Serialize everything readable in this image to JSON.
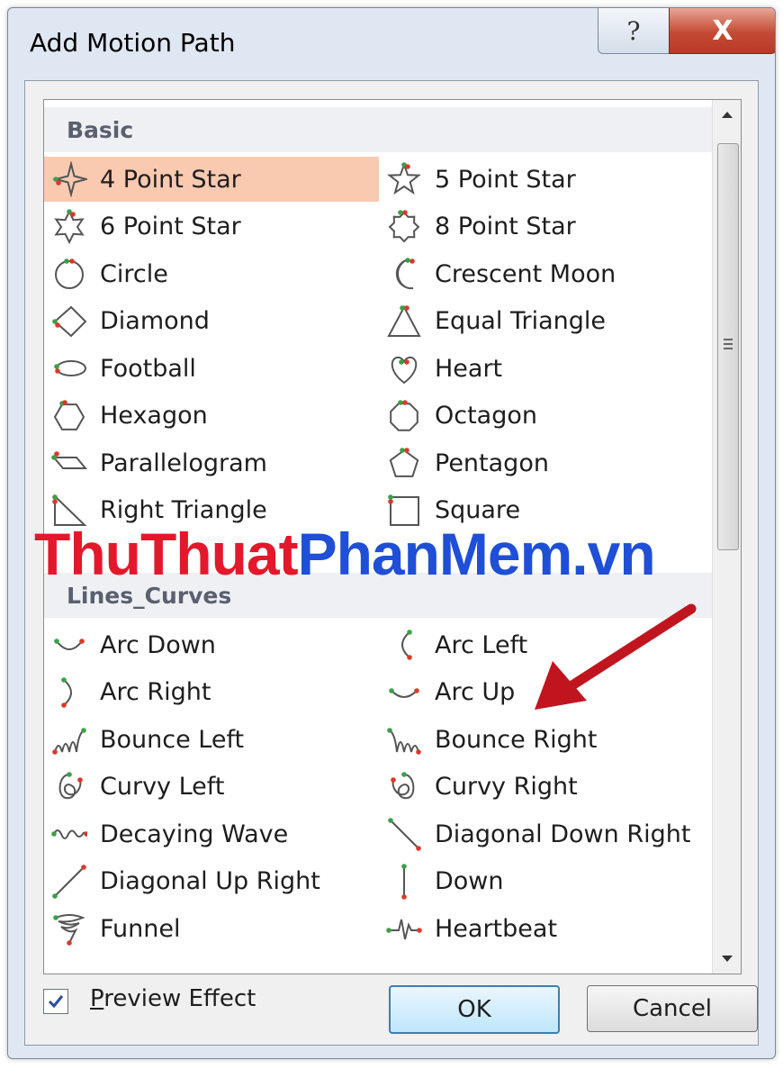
{
  "dialog": {
    "title": "Add Motion Path",
    "help_glyph": "?",
    "close_glyph": "X"
  },
  "groups": [
    {
      "header": "Basic",
      "items": [
        {
          "label": "4 Point Star",
          "icon": "four-point-star-icon",
          "selected": true
        },
        {
          "label": "5 Point Star",
          "icon": "five-point-star-icon"
        },
        {
          "label": "6 Point Star",
          "icon": "six-point-star-icon"
        },
        {
          "label": "8 Point Star",
          "icon": "eight-point-star-icon"
        },
        {
          "label": "Circle",
          "icon": "circle-icon"
        },
        {
          "label": "Crescent Moon",
          "icon": "crescent-moon-icon"
        },
        {
          "label": "Diamond",
          "icon": "diamond-icon"
        },
        {
          "label": "Equal Triangle",
          "icon": "equal-triangle-icon"
        },
        {
          "label": "Football",
          "icon": "football-icon"
        },
        {
          "label": "Heart",
          "icon": "heart-icon"
        },
        {
          "label": "Hexagon",
          "icon": "hexagon-icon"
        },
        {
          "label": "Octagon",
          "icon": "octagon-icon"
        },
        {
          "label": "Parallelogram",
          "icon": "parallelogram-icon"
        },
        {
          "label": "Pentagon",
          "icon": "pentagon-icon"
        },
        {
          "label": "Right Triangle",
          "icon": "right-triangle-icon"
        },
        {
          "label": "Square",
          "icon": "square-icon"
        }
      ]
    },
    {
      "header": "Lines_Curves",
      "items": [
        {
          "label": "Arc Down",
          "icon": "arc-down-icon"
        },
        {
          "label": "Arc Left",
          "icon": "arc-left-icon"
        },
        {
          "label": "Arc Right",
          "icon": "arc-right-icon"
        },
        {
          "label": "Arc Up",
          "icon": "arc-up-icon"
        },
        {
          "label": "Bounce Left",
          "icon": "bounce-left-icon"
        },
        {
          "label": "Bounce Right",
          "icon": "bounce-right-icon"
        },
        {
          "label": "Curvy Left",
          "icon": "curvy-left-icon"
        },
        {
          "label": "Curvy Right",
          "icon": "curvy-right-icon"
        },
        {
          "label": "Decaying Wave",
          "icon": "decaying-wave-icon"
        },
        {
          "label": "Diagonal Down Right",
          "icon": "diagonal-down-right-icon"
        },
        {
          "label": "Diagonal Up Right",
          "icon": "diagonal-up-right-icon"
        },
        {
          "label": "Down",
          "icon": "down-icon"
        },
        {
          "label": "Funnel",
          "icon": "funnel-icon"
        },
        {
          "label": "Heartbeat",
          "icon": "heartbeat-icon"
        }
      ]
    }
  ],
  "watermark": {
    "part1": "ThuThuat",
    "part2": "PhanMem.vn"
  },
  "preview": {
    "label_mnemonic": "P",
    "label_rest": "review Effect",
    "checked": true
  },
  "buttons": {
    "ok": "OK",
    "cancel": "Cancel"
  },
  "colors": {
    "selection": "#f9c9b0",
    "path_start": "#3aa048",
    "path_end": "#d93a2b",
    "arrow": "#c0151f"
  }
}
